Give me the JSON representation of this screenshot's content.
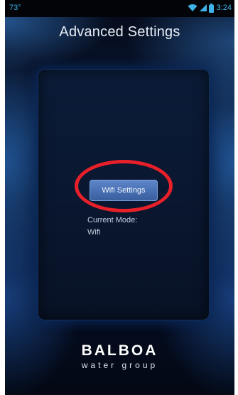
{
  "status_bar": {
    "temperature": "73°",
    "time": "3:24",
    "icons": [
      "wifi-icon",
      "signal-icon",
      "battery-icon"
    ]
  },
  "header": {
    "title": "Advanced Settings"
  },
  "panel": {
    "wifi_button_label": "Wifi Settings",
    "current_mode_label": "Current Mode:",
    "current_mode_value": "Wifi"
  },
  "logo": {
    "brand": "BALBOA",
    "tagline": "water group"
  },
  "colors": {
    "accent": "#3fb3e8",
    "button": "#476fb3",
    "highlight": "#e8202a"
  }
}
